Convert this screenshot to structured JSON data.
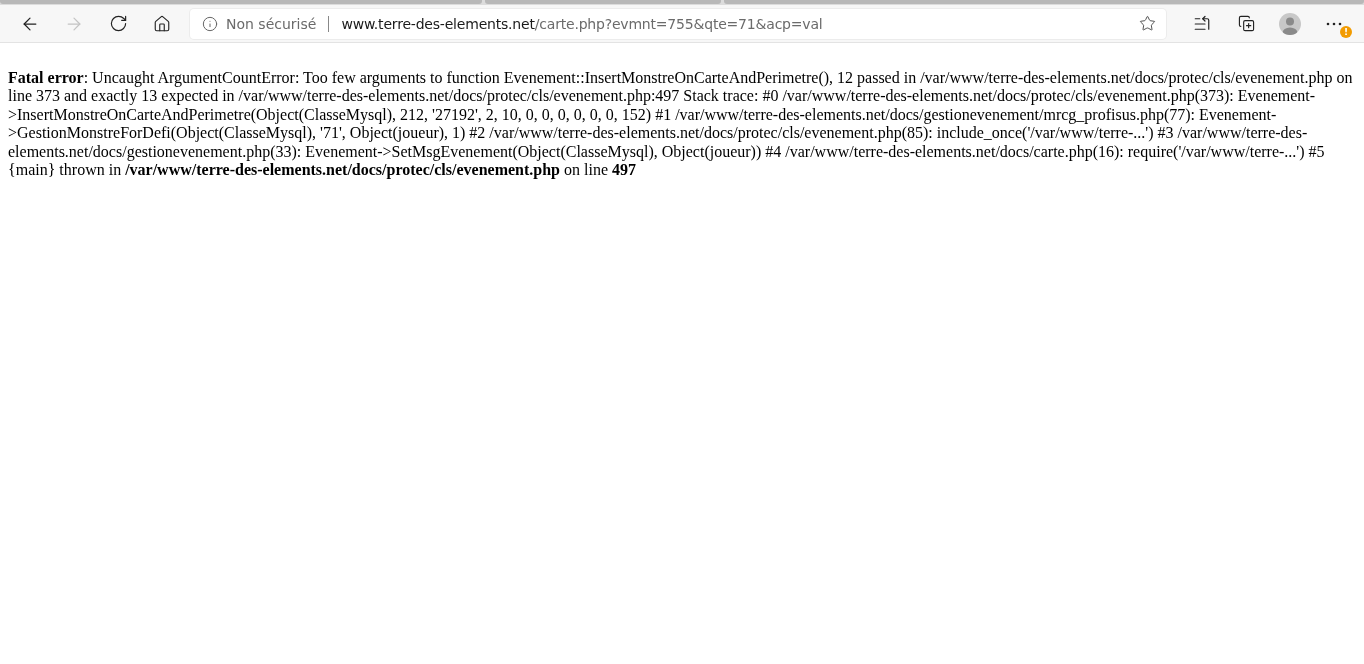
{
  "toolbar": {
    "back": {
      "disabled": false
    },
    "forward": {
      "disabled": true
    },
    "security_label": "Non sécurisé",
    "url_host": "www.terre-des-elements.net",
    "url_path": "/carte.php?evmnt=755&qte=71&acp=val",
    "update_badge": "!"
  },
  "error_message": "**Fatal error**: Uncaught ArgumentCountError: Too few arguments to function Evenement::InsertMonstreOnCarteAndPerimetre(), 12 passed in /var/www/terre-des-elements.net/docs/protec/cls/evenement.php on line 373 and exactly 13 expected in /var/www/terre-des-elements.net/docs/protec/cls/evenement.php:497 Stack trace: #0 /var/www/terre-des-elements.net/docs/protec/cls/evenement.php(373): Evenement->InsertMonstreOnCarteAndPerimetre(Object(ClasseMysql), 212, '27192', 2, 10, 0, 0, 0, 0, 0, 0, 152) #1 /var/www/terre-des-elements.net/docs/gestionevenement/mrcg_profisus.php(77): Evenement->GestionMonstreForDefi(Object(ClasseMysql), '71', Object(joueur), 1) #2 /var/www/terre-des-elements.net/docs/protec/cls/evenement.php(85): include_once('/var/www/terre-...') #3 /var/www/terre-des-elements.net/docs/gestionevenement.php(33): Evenement->SetMsgEvenement(Object(ClasseMysql), Object(joueur)) #4 /var/www/terre-des-elements.net/docs/carte.php(16): require('/var/www/terre-...') #5 {main} thrown in **/var/www/terre-des-elements.net/docs/protec/cls/evenement.php** on line **497**"
}
